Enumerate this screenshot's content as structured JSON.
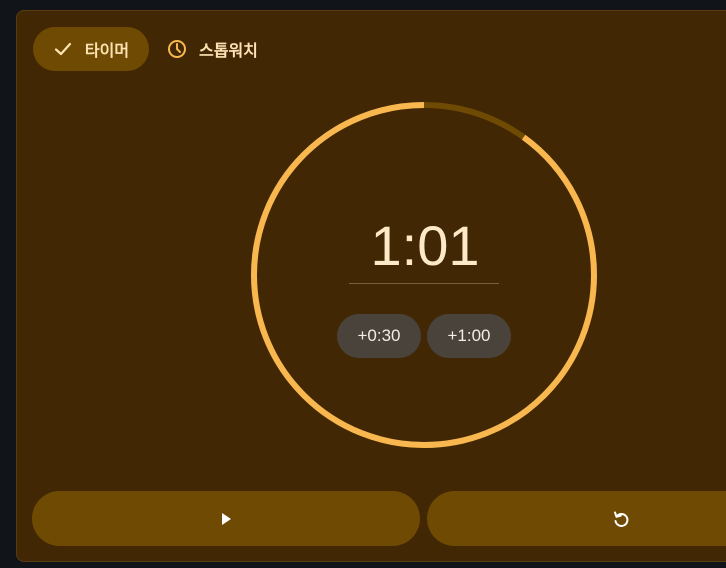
{
  "tabs": {
    "timer_label": "타이머",
    "stopwatch_label": "스톱워치"
  },
  "timer": {
    "display": "1:01",
    "remaining_fraction": 0.9
  },
  "quick_add": {
    "add_30_label": "+0:30",
    "add_60_label": "+1:00"
  },
  "controls": {
    "play_icon": "play-icon",
    "reset_icon": "reset-icon"
  },
  "colors": {
    "background": "#412704",
    "accent": "#f9b74f",
    "ring_track": "#6f4a02",
    "button": "#6f4a02"
  }
}
